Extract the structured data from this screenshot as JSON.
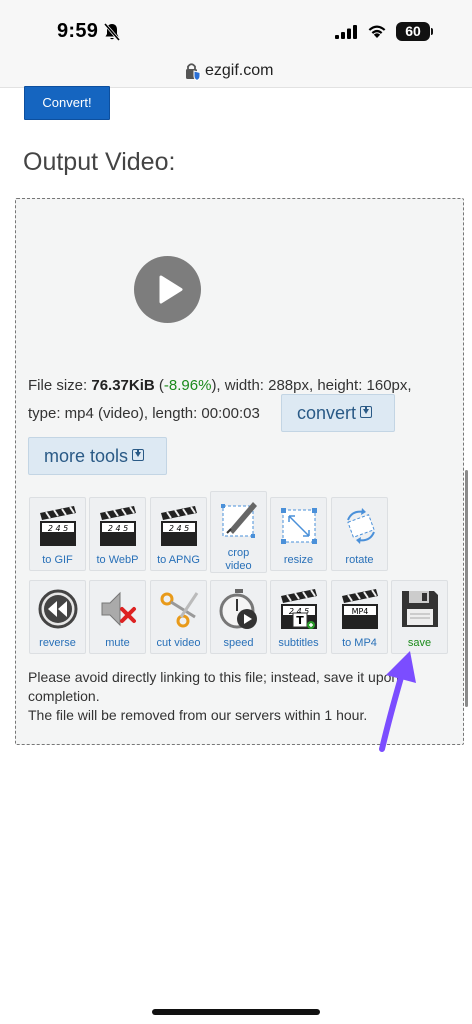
{
  "status_bar": {
    "time": "9:59",
    "battery": "60"
  },
  "address_bar": {
    "url": "ezgif.com"
  },
  "page": {
    "convert_button": "Convert!",
    "output_title": "Output Video:"
  },
  "file_info": {
    "size_label": "File size: ",
    "size_value": "76.37KiB",
    "open_paren": " (",
    "size_change": "-8.96%",
    "rest_line1": "), width: 288px, height: 160px,",
    "rest_line2": "type: mp4 (video), length: 00:00:03"
  },
  "buttons": {
    "convert": "convert",
    "more_tools": "more tools"
  },
  "tools": [
    {
      "label": "to GIF",
      "icon": "clapperboard-245-icon"
    },
    {
      "label": "to WebP",
      "icon": "clapperboard-245-icon"
    },
    {
      "label": "to APNG",
      "icon": "clapperboard-245-icon"
    },
    {
      "label": "crop video",
      "icon": "crop-icon"
    },
    {
      "label": "resize",
      "icon": "resize-icon"
    },
    {
      "label": "rotate",
      "icon": "rotate-icon"
    },
    {
      "label": "reverse",
      "icon": "rewind-icon"
    },
    {
      "label": "mute",
      "icon": "mute-icon"
    },
    {
      "label": "cut video",
      "icon": "scissors-icon"
    },
    {
      "label": "speed",
      "icon": "stopwatch-icon"
    },
    {
      "label": "subtitles",
      "icon": "subtitles-icon"
    },
    {
      "label": "to MP4",
      "icon": "clapperboard-mp4-icon"
    },
    {
      "label": "save",
      "icon": "floppy-disk-icon"
    }
  ],
  "notice": {
    "line1": "Please avoid directly linking to this file; instead, save it upon",
    "line2": "completion.",
    "line3": "The file will be removed from our servers within 1 hour."
  },
  "colors": {
    "accent": "#1565c0",
    "annotation_arrow": "#7b4dff",
    "save_label": "#1a8a1a"
  }
}
